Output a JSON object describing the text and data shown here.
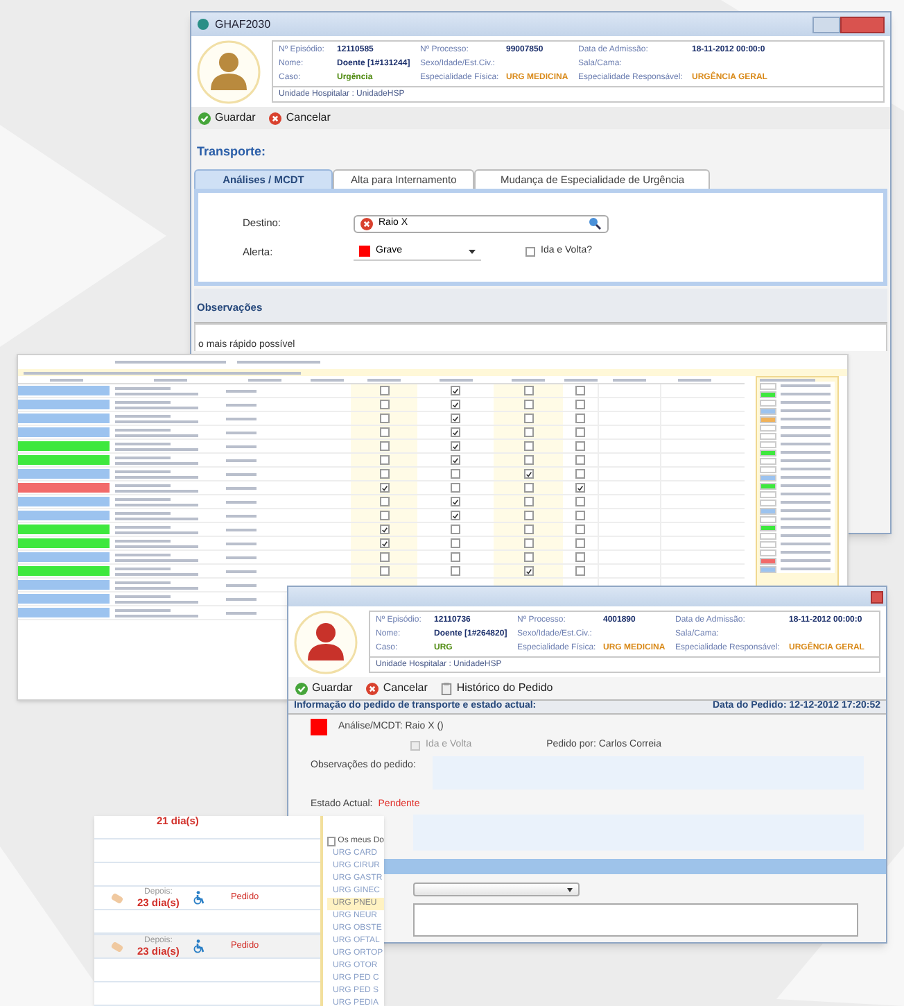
{
  "main_window": {
    "title": "GHAF2030",
    "patient": [
      [
        {
          "label": "Nº Episódio:",
          "value": "12110585",
          "kind": "bold"
        },
        {
          "label": "Nº Processo:",
          "value": "99007850",
          "kind": "bold"
        },
        {
          "label": "Data de Admissão:",
          "value": "18-11-2012 00:00:0",
          "kind": "bold"
        }
      ],
      [
        {
          "label": "Nome:",
          "value": "Doente [1#131244]",
          "kind": "bold"
        },
        {
          "label": "Sexo/Idade/Est.Civ.:"
        },
        {
          "label": "Sala/Cama:"
        }
      ],
      [
        {
          "label": "Caso:",
          "value": "Urgência",
          "kind": "green"
        },
        {
          "label": "Especialidade Física:",
          "value": "URG MEDICINA",
          "kind": "orange"
        },
        {
          "label": "Especialidade Responsável:",
          "value": "URGÊNCIA GERAL",
          "kind": "orange"
        }
      ]
    ],
    "unit": "Unidade Hospitalar : UnidadeHSP",
    "toolbar": [
      {
        "label": "Guardar",
        "kind": "save"
      },
      {
        "label": "Cancelar",
        "kind": "cancel"
      }
    ],
    "section_title": "Transporte:",
    "tabs": [
      {
        "label": "Análises / MCDT",
        "selected": true
      },
      {
        "label": "Alta para Internamento",
        "selected": false
      },
      {
        "label": "Mudança de Especialidade de Urgência",
        "selected": false
      }
    ],
    "destination": {
      "label": "Destino:",
      "value": "Raio X"
    },
    "alert": {
      "label": "Alerta:",
      "value": "Grave",
      "color": "#ff0000"
    },
    "round_trip": {
      "label": "Ida e Volta?",
      "checked": false
    },
    "notes_title": "Observações",
    "notes_text": "o mais rápido possível"
  },
  "grid_window": {
    "rows": [
      {
        "color": "#9cc3ef",
        "checks": [
          false,
          true,
          false,
          false
        ]
      },
      {
        "color": "#9cc3ef",
        "checks": [
          false,
          true,
          false,
          false
        ]
      },
      {
        "color": "#9cc3ef",
        "checks": [
          false,
          true,
          false,
          false
        ]
      },
      {
        "color": "#9cc3ef",
        "checks": [
          false,
          true,
          false,
          false
        ]
      },
      {
        "color": "#3ee83e",
        "checks": [
          false,
          true,
          false,
          false
        ]
      },
      {
        "color": "#3ee83e",
        "checks": [
          false,
          true,
          false,
          false
        ]
      },
      {
        "color": "#9cc3ef",
        "checks": [
          false,
          false,
          true,
          false
        ]
      },
      {
        "color": "#f26a6a",
        "checks": [
          true,
          false,
          false,
          true
        ]
      },
      {
        "color": "#9cc3ef",
        "checks": [
          false,
          true,
          false,
          false
        ]
      },
      {
        "color": "#9cc3ef",
        "checks": [
          false,
          true,
          false,
          false
        ]
      },
      {
        "color": "#3ee83e",
        "checks": [
          true,
          false,
          false,
          false
        ]
      },
      {
        "color": "#3ee83e",
        "checks": [
          true,
          false,
          false,
          false
        ]
      },
      {
        "color": "#9cc3ef",
        "checks": [
          false,
          false,
          false,
          false
        ]
      },
      {
        "color": "#3ee83e",
        "checks": [
          false,
          false,
          true,
          false
        ]
      },
      {
        "color": "#9cc3ef"
      },
      {
        "color": "#9cc3ef"
      },
      {
        "color": "#9cc3ef"
      }
    ],
    "specialties": [
      {
        "color": "#ffffff"
      },
      {
        "color": "#3ee83e"
      },
      {
        "color": "#ffffff"
      },
      {
        "color": "#9cc3ef"
      },
      {
        "color": "#f0b25a"
      },
      {
        "color": "#ffffff"
      },
      {
        "color": "#ffffff"
      },
      {
        "color": "#ffffff"
      },
      {
        "color": "#3ee83e"
      },
      {
        "color": "#ffffff"
      },
      {
        "color": "#ffffff"
      },
      {
        "color": "#9cc3ef"
      },
      {
        "color": "#3ee83e"
      },
      {
        "color": "#ffffff"
      },
      {
        "color": "#ffffff"
      },
      {
        "color": "#9cc3ef"
      },
      {
        "color": "#ffffff"
      },
      {
        "color": "#3ee83e"
      },
      {
        "color": "#ffffff"
      },
      {
        "color": "#ffffff"
      },
      {
        "color": "#ffffff"
      },
      {
        "color": "#f26a6a"
      },
      {
        "color": "#9cc3ef"
      }
    ]
  },
  "request_window": {
    "patient": [
      [
        {
          "label": "Nº Episódio:",
          "value": "12110736",
          "kind": "bold"
        },
        {
          "label": "Nº Processo:",
          "value": "4001890",
          "kind": "bold"
        },
        {
          "label": "Data de Admissão:",
          "value": "18-11-2012 00:00:0",
          "kind": "bold"
        }
      ],
      [
        {
          "label": "Nome:",
          "value": "Doente [1#264820]",
          "kind": "bold"
        },
        {
          "label": "Sexo/Idade/Est.Civ.:"
        },
        {
          "label": "Sala/Cama:"
        }
      ],
      [
        {
          "label": "Caso:",
          "value": "URG",
          "kind": "green"
        },
        {
          "label": "Especialidade Física:",
          "value": "URG MEDICINA",
          "kind": "orange"
        },
        {
          "label": "Especialidade Responsável:",
          "value": "URGÊNCIA GERAL",
          "kind": "orange"
        }
      ]
    ],
    "unit": "Unidade Hospitalar : UnidadeHSP",
    "toolbar": [
      {
        "label": "Guardar",
        "kind": "save"
      },
      {
        "label": "Cancelar",
        "kind": "cancel"
      },
      {
        "label": "Histórico do Pedido",
        "kind": "history"
      }
    ],
    "info_title": "Informação do pedido de transporte e estado actual:",
    "request_date": "Data do Pedido: 12-12-2012 17:20:52",
    "analysis": {
      "text": "Análise/MCDT: Raio X ()",
      "color": "#ff0000"
    },
    "round_trip": {
      "label": "Ida e Volta",
      "checked": false,
      "disabled": true
    },
    "requested_by": "Pedido por: Carlos Correia",
    "notes_label": "Observações do pedido:",
    "status_label": "Estado Actual:",
    "status_value": "Pendente"
  },
  "list_window": {
    "rows": [
      {
        "kind": "days",
        "value": "21 dia(s)",
        "selected": false
      },
      {
        "kind": "blank",
        "selected": false
      },
      {
        "kind": "blank",
        "selected": false
      },
      {
        "kind": "request",
        "label": "Depois:",
        "value": "23 dia(s)",
        "status": "Pedido",
        "selected": false
      },
      {
        "kind": "blank",
        "selected": false
      },
      {
        "kind": "request",
        "label": "Depois:",
        "value": "23 dia(s)",
        "status": "Pedido",
        "selected": true
      },
      {
        "kind": "blank",
        "selected": false
      },
      {
        "kind": "blank",
        "selected": false
      }
    ],
    "filter": {
      "label": "Os meus Do",
      "checked": false
    },
    "specialties": [
      {
        "label": "URG CARD",
        "selected": false
      },
      {
        "label": "URG CIRUR",
        "selected": false
      },
      {
        "label": "URG GASTR",
        "selected": false
      },
      {
        "label": "URG GINEC",
        "selected": false
      },
      {
        "label": "URG PNEU",
        "selected": true
      },
      {
        "label": "URG NEUR",
        "selected": false
      },
      {
        "label": "URG OBSTE",
        "selected": false
      },
      {
        "label": "URG OFTAL",
        "selected": false
      },
      {
        "label": "URG ORTOP",
        "selected": false
      },
      {
        "label": "URG OTOR",
        "selected": false
      },
      {
        "label": "URG PED C",
        "selected": false
      },
      {
        "label": "URG PED S",
        "selected": false
      },
      {
        "label": "URG PEDIA",
        "selected": false
      }
    ]
  }
}
